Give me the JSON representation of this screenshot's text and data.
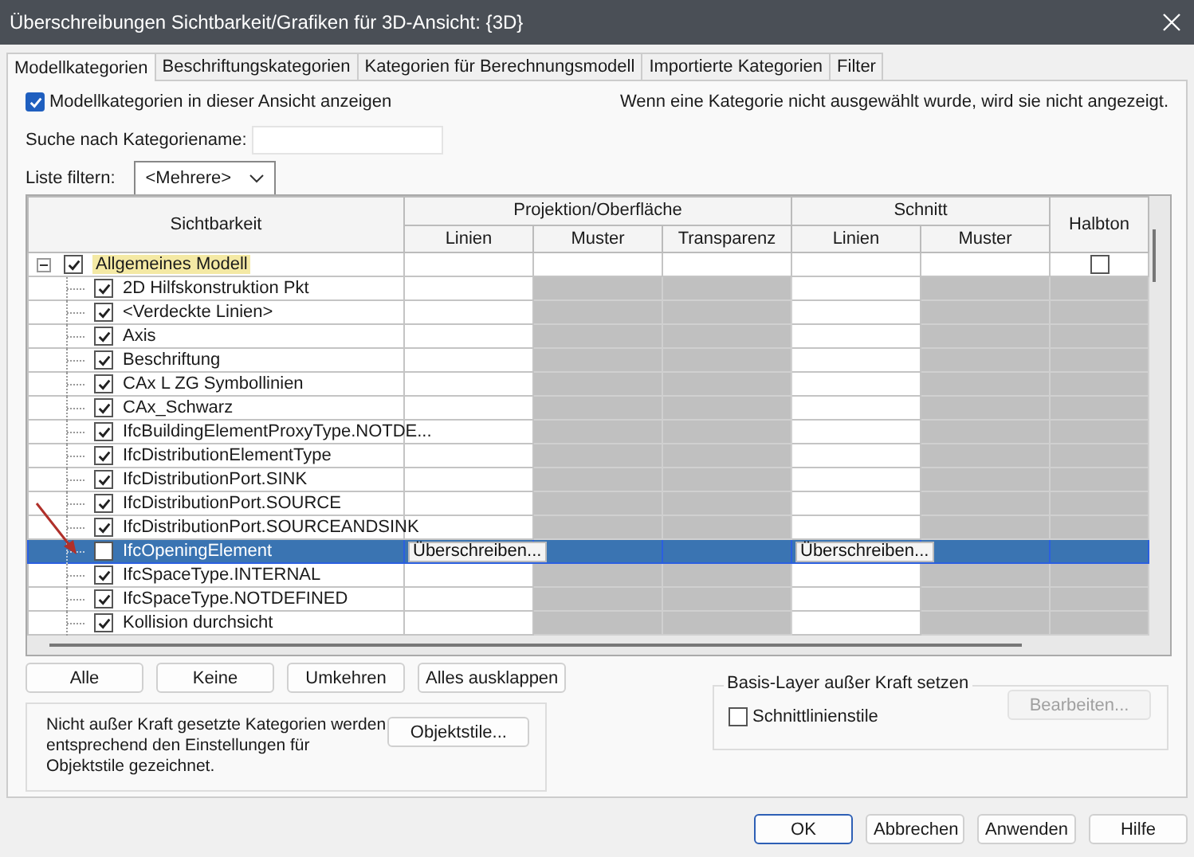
{
  "window": {
    "title": "Überschreibungen Sichtbarkeit/Grafiken für 3D-Ansicht: {3D}"
  },
  "tabs": [
    {
      "label": "Modellkategorien",
      "selected": true
    },
    {
      "label": "Beschriftungskategorien",
      "selected": false
    },
    {
      "label": "Kategorien für Berechnungsmodell",
      "selected": false
    },
    {
      "label": "Importierte Kategorien",
      "selected": false
    },
    {
      "label": "Filter",
      "selected": false
    }
  ],
  "show_categories": {
    "label": "Modellkategorien in dieser Ansicht anzeigen",
    "checked": true
  },
  "info_text": "Wenn eine Kategorie nicht ausgewählt wurde, wird sie nicht angezeigt.",
  "search": {
    "label": "Suche nach Kategoriename:"
  },
  "filter": {
    "label": "Liste filtern:",
    "value": "<Mehrere>"
  },
  "table": {
    "visibility_header": "Sichtbarkeit",
    "halftone_header": "Halbton",
    "groups": [
      {
        "label": "Projektion/Oberfläche",
        "columns": [
          {
            "label": "Linien",
            "editable": true
          },
          {
            "label": "Muster",
            "editable": false
          },
          {
            "label": "Transparenz",
            "editable": false
          }
        ]
      },
      {
        "label": "Schnitt",
        "columns": [
          {
            "label": "Linien",
            "editable": true
          },
          {
            "label": "Muster",
            "editable": false
          }
        ]
      }
    ],
    "tree": [
      {
        "label": "Allgemeines Modell",
        "checked": true,
        "expanded": true,
        "highlighted": true,
        "halftone_checked": false,
        "children": [
          {
            "label": "2D Hilfskonstruktion Pkt",
            "checked": true,
            "selected": false
          },
          {
            "label": "<Verdeckte Linien>",
            "checked": true,
            "selected": false
          },
          {
            "label": "Axis",
            "checked": true,
            "selected": false
          },
          {
            "label": "Beschriftung",
            "checked": true,
            "selected": false
          },
          {
            "label": "CAx L ZG Symbollinien",
            "checked": true,
            "selected": false
          },
          {
            "label": "CAx_Schwarz",
            "checked": true,
            "selected": false
          },
          {
            "label": "IfcBuildingElementProxyType.NOTDE...",
            "checked": true,
            "selected": false
          },
          {
            "label": "IfcDistributionElementType",
            "checked": true,
            "selected": false
          },
          {
            "label": "IfcDistributionPort.SINK",
            "checked": true,
            "selected": false
          },
          {
            "label": "IfcDistributionPort.SOURCE",
            "checked": true,
            "selected": false
          },
          {
            "label": "IfcDistributionPort.SOURCEANDSINK",
            "checked": true,
            "selected": false
          },
          {
            "label": "IfcOpeningElement",
            "checked": false,
            "selected": true,
            "overrides": [
              "Überschreiben...",
              "Überschreiben..."
            ]
          },
          {
            "label": "IfcSpaceType.INTERNAL",
            "checked": true,
            "selected": false
          },
          {
            "label": "IfcSpaceType.NOTDEFINED",
            "checked": true,
            "selected": false
          },
          {
            "label": "Kollision durchsicht",
            "checked": true,
            "selected": false
          }
        ]
      }
    ]
  },
  "list_buttons": [
    "Alle",
    "Keine",
    "Umkehren",
    "Alles ausklappen"
  ],
  "note": {
    "text": "Nicht außer Kraft gesetzte Kategorien werden entsprechend den Einstellungen für Objektstile gezeichnet.",
    "button": "Objektstile..."
  },
  "base_layer": {
    "title": "Basis-Layer außer Kraft setzen",
    "checkbox": {
      "label": "Schnittlinienstile",
      "checked": false
    },
    "button": {
      "label": "Bearbeiten...",
      "disabled": true
    }
  },
  "footer_buttons": [
    {
      "label": "OK",
      "default": true
    },
    {
      "label": "Abbrechen",
      "default": false
    },
    {
      "label": "Anwenden",
      "default": false
    },
    {
      "label": "Hilfe",
      "default": false
    }
  ]
}
